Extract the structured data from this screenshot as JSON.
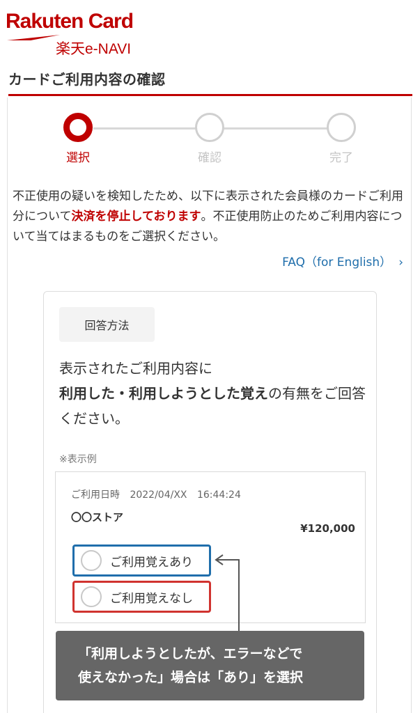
{
  "brand": {
    "logo_text": "Rakuten Card",
    "sub_text": "楽天e-NAVI"
  },
  "header": {
    "title": "カードご利用内容の確認"
  },
  "stepper": {
    "steps": [
      {
        "label": "選択",
        "active": true
      },
      {
        "label": "確認",
        "active": false
      },
      {
        "label": "完了",
        "active": false
      }
    ]
  },
  "intro": {
    "part1": "不正使用の疑いを検知したため、以下に表示された会員様のカードご利用分について",
    "highlight": "決済を停止しております",
    "part2": "。不正使用防止のためご利用内容について当てはまるものをご選択ください。"
  },
  "faq": {
    "label": "FAQ（for English）",
    "chevron": "›"
  },
  "answer_method": {
    "tag": "回答方法",
    "line1": "表示されたご利用内容に",
    "bold": "利用した・利用しようとした覚え",
    "line2": "の有無をご回答ください。"
  },
  "example": {
    "note": "※表示例",
    "date_label": "ご利用日時",
    "date_value": "2022/04/XX",
    "time_value": "16:44:24",
    "store": "〇〇ストア",
    "amount": "¥120,000",
    "option_yes": "ご利用覚えあり",
    "option_no": "ご利用覚えなし"
  },
  "callout": {
    "line1": "「利用しようとしたが、エラーなどで",
    "line2": "使えなかった」場合は「あり」を選択"
  },
  "colors": {
    "brand_red": "#bf0000",
    "link_blue": "#1f6eab",
    "yes_border": "#1f6eab",
    "no_border": "#d0332f",
    "callout_bg": "#666666"
  }
}
